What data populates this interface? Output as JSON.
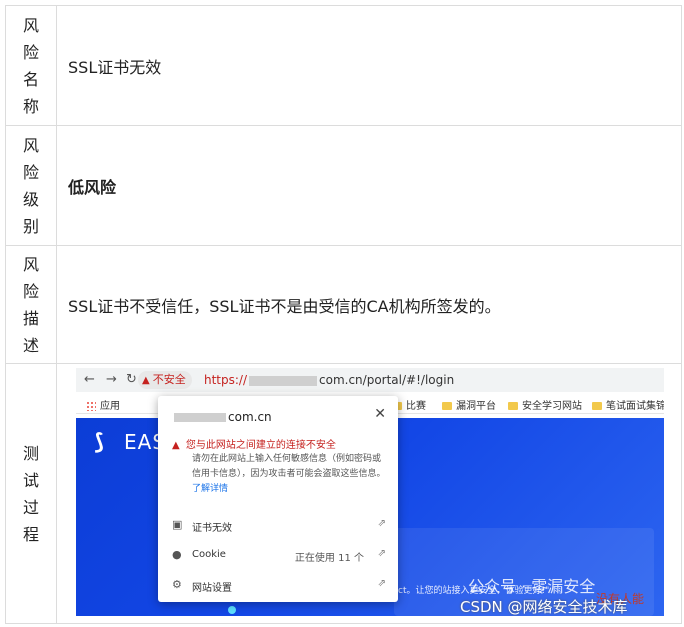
{
  "rows": [
    {
      "label": "风险名称",
      "label_chars": [
        "风",
        "险",
        "名",
        "称"
      ],
      "value": "SSL证书无效"
    },
    {
      "label": "风险级别",
      "label_chars": [
        "风",
        "险",
        "级",
        "别"
      ],
      "value": "低风险"
    },
    {
      "label": "风险描述",
      "label_chars": [
        "风",
        "险",
        "描",
        "述"
      ],
      "value": "SSL证书不受信任，SSL证书不是由受信的CA机构所签发的。"
    },
    {
      "label": "测试过程",
      "label_chars": [
        "测",
        "试",
        "过",
        "程"
      ]
    }
  ],
  "screenshot": {
    "not_secure": "不安全",
    "url_scheme": "https://",
    "url_rest": "com.cn/portal/#!/login",
    "bookmarks": [
      "应用",
      "比赛",
      "漏洞平台",
      "安全学习网站",
      "笔试面试集锦"
    ],
    "logo_text": "EAS",
    "popup_domain": "com.cn",
    "popup_warning": "您与此网站之间建立的连接不安全",
    "popup_desc": "请勿在此网站上输入任何敏感信息（例如密码或信用卡信息），因为攻击者可能会盗取这些信息。",
    "popup_learn_more": "了解详情",
    "popup_items": [
      {
        "label": "证书无效",
        "status": ""
      },
      {
        "label": "Cookie",
        "status": "正在使用 11 个"
      },
      {
        "label": "网站设置",
        "status": ""
      }
    ],
    "slogan": "ct。让您的站接入更安全，体验更好!\"",
    "watermark_public": "公众号 · 零漏安全",
    "watermark_red": "没有人能",
    "watermark_csdn": "CSDN @网络安全技术库"
  }
}
